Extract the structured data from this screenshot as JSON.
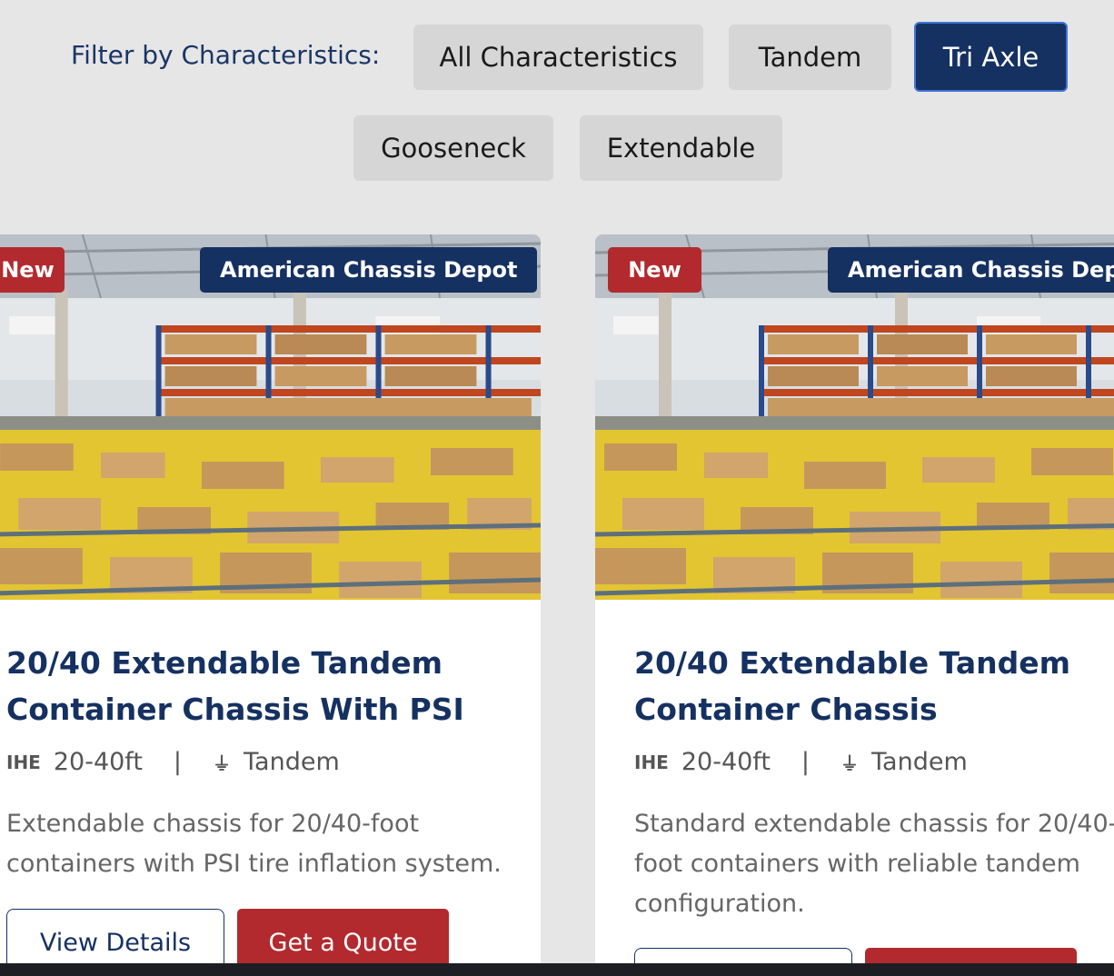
{
  "filter": {
    "label": "Filter by Characteristics:",
    "options": [
      "All Characteristics",
      "Tandem",
      "Tri Axle",
      "Gooseneck",
      "Extendable"
    ],
    "active": "Tri Axle"
  },
  "cards": [
    {
      "badge": "New",
      "dealer": "American Chassis Depot",
      "title_line1": "20/40 Extendable Tandem",
      "title_line2": "Container Chassis With PSI",
      "size": "20-40ft",
      "axle": "Tandem",
      "desc_line1": "Extendable chassis for 20/40-foot",
      "desc_line2": "containers with PSI tire inflation system.",
      "desc_line3": "",
      "details_label": "View Details",
      "quote_label": "Get a Quote"
    },
    {
      "badge": "New",
      "dealer": "American Chassis Depot",
      "title_line1": "20/40 Extendable Tandem",
      "title_line2": "Container Chassis",
      "size": "20-40ft",
      "axle": "Tandem",
      "desc_line1": "Standard extendable chassis for 20/40-",
      "desc_line2": "foot containers with reliable tandem",
      "desc_line3": "configuration."
    }
  ],
  "spec_icons": {
    "size": "ruler-icon",
    "axle": "axle-icon"
  },
  "colors": {
    "navy": "#153161",
    "red": "#b22a2e",
    "background": "#e6e6e6"
  }
}
